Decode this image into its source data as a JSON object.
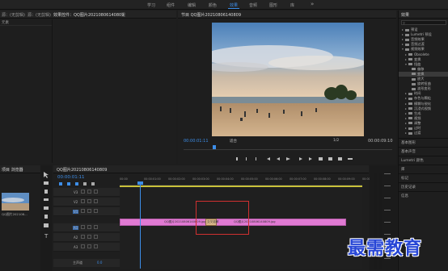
{
  "workspaces": [
    "学习",
    "组件",
    "编辑",
    "颜色",
    "效果",
    "音频",
    "图形",
    "库"
  ],
  "active_workspace": "效果",
  "overflow_glyph": "»",
  "top_left": {
    "tab1": "源：(无剪辑)",
    "tab2": "效果控件：QQ图片20210806140809",
    "tab3_short": "混",
    "row_label": "元素"
  },
  "program": {
    "title": "节目 QQ图片20210806140809",
    "timecode_left": "00:00:01:11",
    "fit": "适合",
    "fraction": "1/2",
    "timecode_right": "00:00:09:10"
  },
  "effects": {
    "title": "效果",
    "items": [
      {
        "label": "预设",
        "indent": 1,
        "open": false
      },
      {
        "label": "Lumetri 预设",
        "indent": 1,
        "open": false
      },
      {
        "label": "音频效果",
        "indent": 1,
        "open": false
      },
      {
        "label": "音频过渡",
        "indent": 1,
        "open": false
      },
      {
        "label": "视频效果",
        "indent": 1,
        "open": true
      },
      {
        "label": "Obsolete",
        "indent": 2,
        "open": false
      },
      {
        "label": "变换",
        "indent": 2,
        "open": false
      },
      {
        "label": "扭曲",
        "indent": 2,
        "open": true
      },
      {
        "label": "偏移",
        "indent": 3,
        "open": false
      },
      {
        "label": "变换",
        "indent": 3,
        "open": false
      },
      {
        "label": "放大",
        "indent": 3,
        "open": false
      },
      {
        "label": "旋转扭曲",
        "indent": 3,
        "open": false
      },
      {
        "label": "波形变形",
        "indent": 3,
        "open": false
      },
      {
        "label": "时间",
        "indent": 2,
        "open": false
      },
      {
        "label": "杂色与颗粒",
        "indent": 2,
        "open": false
      },
      {
        "label": "模糊与锐化",
        "indent": 2,
        "open": false
      },
      {
        "label": "沉浸式视频",
        "indent": 2,
        "open": false
      },
      {
        "label": "生成",
        "indent": 2,
        "open": false
      },
      {
        "label": "视频",
        "indent": 2,
        "open": false
      },
      {
        "label": "调整",
        "indent": 2,
        "open": false
      },
      {
        "label": "过时",
        "indent": 2,
        "open": false
      },
      {
        "label": "过渡",
        "indent": 2,
        "open": false
      }
    ],
    "selected_index": 9,
    "sections": [
      "基本图形",
      "基本声音",
      "Lumetri 颜色",
      "库",
      "标记",
      "历史记录",
      "信息"
    ]
  },
  "project": {
    "tab": "项目 浏览器",
    "clip_name": "QQ图片202108...",
    "clip_duration": "5:00"
  },
  "timeline": {
    "tab": "QQ图片20210806140809",
    "timecode": "00:00:01:11",
    "ruler": [
      "00:00",
      "00:00:01:00",
      "00:00:02:00",
      "00:00:03:00",
      "00:00:04:00",
      "00:00:05:00",
      "00:00:06:00",
      "00:00:07:00",
      "00:00:08:00",
      "00:00:09:00",
      "00:00:10:00"
    ],
    "video_tracks": [
      "V3",
      "V2",
      "V1"
    ],
    "audio_tracks": [
      "A1",
      "A2",
      "A3"
    ],
    "master": "主声道",
    "master_value": "0.0",
    "clip1": "QQ图片20210806140809.jpg",
    "transition": "交叉溶解",
    "clip2": "QQ图片20210806140809.jpg",
    "colors": {
      "clip": "#e07ad3",
      "playhead": "#3d8ee8",
      "transition_box": "#d03030",
      "accent": "#3d8ee8"
    }
  },
  "watermark": "最需教育"
}
